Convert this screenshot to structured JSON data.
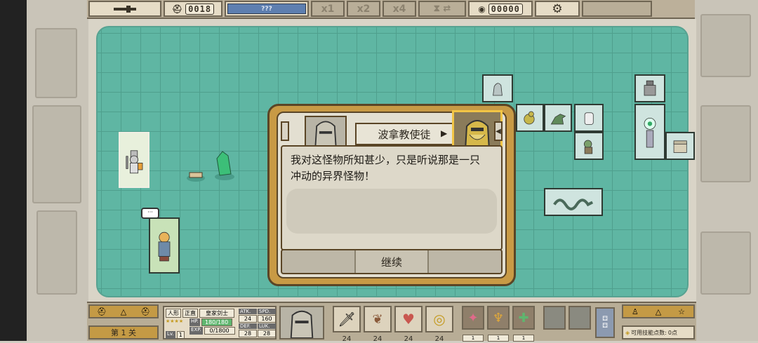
{
  "topbar": {
    "timer": "0018",
    "progress_label": "???",
    "speed_x1": "x1",
    "speed_x2": "x2",
    "speed_x4": "x4",
    "coins": "00000"
  },
  "dialog": {
    "speaker": "波拿教使徒",
    "text": "我对这怪物所知甚少，只是听说那是一只冲动的异界怪物！",
    "continue_label": "继续"
  },
  "hero": {
    "race": "人形",
    "alignment": "正直",
    "class": "皇家剑士",
    "level_label": "Lv.",
    "level": "1",
    "hp_label": "HP.",
    "hp": "180/180",
    "exp_label": "EXP.",
    "exp": "0/1800",
    "atk_label": "ATK.",
    "atk": "24",
    "spd_label": "SPD.",
    "spd": "160",
    "def_label": "DEF.",
    "def": "28",
    "luk_label": "LUK.",
    "luk": "28"
  },
  "stage": {
    "label": "第 1 关"
  },
  "skills": [
    {
      "icon": "sword-icon",
      "value": "24"
    },
    {
      "icon": "wing-icon",
      "value": "24"
    },
    {
      "icon": "heart-icon",
      "value": "24"
    },
    {
      "icon": "coin-icon",
      "value": "24"
    }
  ],
  "items": [
    {
      "icon": "shuriken-icon",
      "value": "1"
    },
    {
      "icon": "claw-icon",
      "value": "1"
    },
    {
      "icon": "clover-icon",
      "value": "1"
    },
    {
      "icon": "empty-slot",
      "value": ""
    },
    {
      "icon": "empty-slot",
      "value": ""
    }
  ],
  "skill_points": {
    "label": "可用技能点数:",
    "value": "0点"
  },
  "colors": {
    "board": "#5fb6a3",
    "dialog_gold": "#c89a45",
    "portrait_highlight": "#f2c545"
  }
}
